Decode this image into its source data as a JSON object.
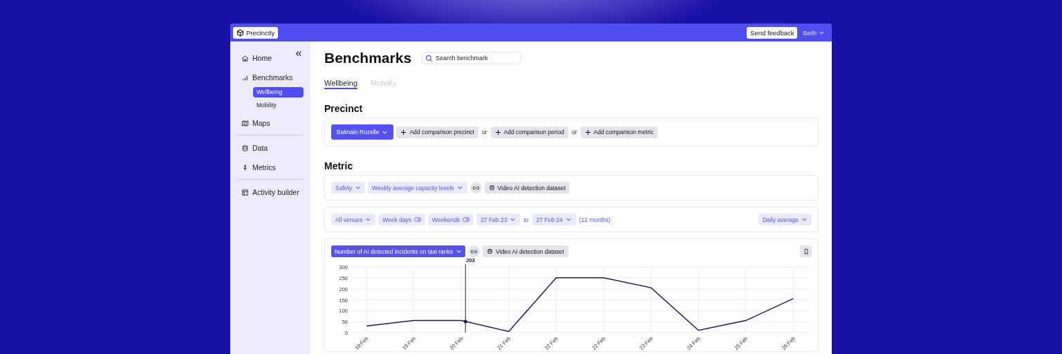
{
  "top_bar": {
    "logo": "Precinctly",
    "feedback_button": "Send feedback",
    "user": "Beth"
  },
  "sidebar": {
    "groups": [
      [
        {
          "label": "Home",
          "selected": false
        },
        {
          "label": "Benchmarks",
          "selected": false,
          "children": [
            {
              "label": "Wellbeing",
              "selected": true
            },
            {
              "label": "Mobility",
              "selected": false
            }
          ]
        },
        {
          "label": "Maps",
          "selected": false
        }
      ],
      [
        {
          "label": "Data",
          "selected": false
        },
        {
          "label": "Metrics",
          "selected": false
        }
      ],
      [
        {
          "label": "Activity builder",
          "selected": false
        }
      ]
    ]
  },
  "page": {
    "title": "Benchmarks",
    "search": {
      "placeholder": "Search benchmark"
    },
    "tabs": [
      {
        "label": "Wellbeing",
        "selected": true
      },
      {
        "label": "Mobility",
        "selected": false
      }
    ],
    "precinct": {
      "heading": "Precinct",
      "chips": [
        {
          "kind": "primary",
          "label": "Balmain Rozelle"
        },
        {
          "kind": "add",
          "label": "Add comparison precinct"
        },
        {
          "kind": "text",
          "label": "or"
        },
        {
          "kind": "add",
          "label": "Add comparison period"
        },
        {
          "kind": "text",
          "label": "or"
        },
        {
          "kind": "add",
          "label": "Add comparison metric"
        }
      ]
    },
    "metric": {
      "heading": "Metric",
      "chips": [
        {
          "kind": "select",
          "label": "Safety"
        },
        {
          "kind": "select",
          "label": "Weekly average capacity levels"
        },
        {
          "kind": "link"
        },
        {
          "kind": "dataset",
          "label": "Video AI detection dataset"
        }
      ],
      "filters": [
        {
          "kind": "select",
          "label": "All venues"
        },
        {
          "kind": "toggle",
          "label": "Week days"
        },
        {
          "kind": "toggle",
          "label": "Weekends"
        },
        {
          "kind": "select",
          "label": "27 Feb 23"
        },
        {
          "kind": "text",
          "label": "to"
        },
        {
          "kind": "select",
          "label": "27 Feb 24"
        },
        {
          "kind": "note",
          "label": "(12 months)"
        }
      ],
      "aggregation": {
        "kind": "select",
        "label": "Daily average"
      }
    },
    "chart_card": {
      "chips": [
        {
          "kind": "primary",
          "label": "Number of AI detected incidents on taxi ranks"
        },
        {
          "kind": "link"
        },
        {
          "kind": "dataset",
          "label": "Video AI detection dataset"
        }
      ],
      "chart_data": {
        "type": "line",
        "categories": [
          "18 Feb",
          "19 Feb",
          "20 Feb",
          "21 Feb",
          "22 Feb",
          "22 Feb",
          "23 Feb",
          "24 Feb",
          "25 Feb",
          "26 Feb"
        ],
        "series": [
          {
            "color": "#1e1b4b",
            "values": [
              30,
              55,
              55,
              5,
              250,
              250,
              205,
              10,
              55,
              155
            ]
          }
        ],
        "grid": true,
        "ylim": [
          0,
          300
        ],
        "yticks": [
          0,
          50,
          100,
          150,
          200,
          250,
          300
        ],
        "annotations": [
          "203"
        ]
      }
    }
  }
}
